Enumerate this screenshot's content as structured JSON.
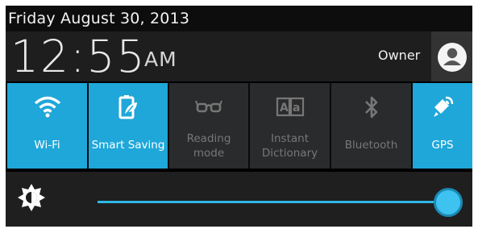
{
  "header": {
    "date": "Friday August 30, 2013"
  },
  "clock": {
    "time": "12:55",
    "ampm": "AM"
  },
  "user": {
    "name": "Owner"
  },
  "tiles": [
    {
      "label": "Wi-Fi",
      "active": true,
      "icon": "wifi-icon"
    },
    {
      "label": "Smart Saving",
      "active": true,
      "icon": "battery-leaf-icon"
    },
    {
      "label_line1": "Reading",
      "label_line2": "mode",
      "active": false,
      "icon": "glasses-icon"
    },
    {
      "label_line1": "Instant",
      "label_line2": "Dictionary",
      "active": false,
      "icon": "dictionary-icon"
    },
    {
      "label": "Bluetooth",
      "active": false,
      "icon": "bluetooth-icon"
    },
    {
      "label": "GPS",
      "active": true,
      "icon": "gps-icon"
    }
  ],
  "brightness": {
    "level": 1.0,
    "icon": "brightness-icon"
  },
  "colors": {
    "accent": "#1fa7d9",
    "tile_inactive": "#2a2b2c",
    "background": "#000000"
  }
}
